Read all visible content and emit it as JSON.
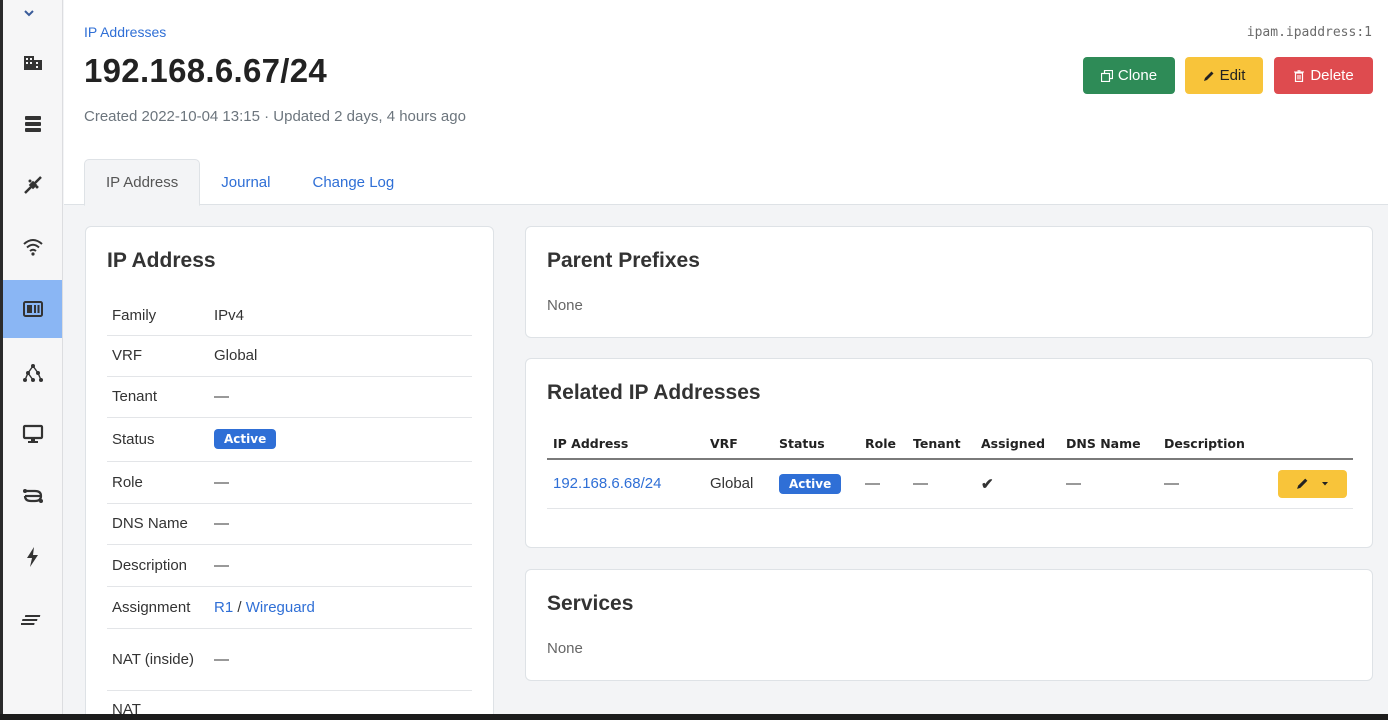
{
  "header": {
    "breadcrumb": "IP Addresses",
    "title": "192.168.6.67/24",
    "meta": "Created 2022-10-04 13:15 · Updated 2 days, 4 hours ago",
    "object_id": "ipam.ipaddress:1",
    "buttons": {
      "clone": "Clone",
      "edit": "Edit",
      "delete": "Delete"
    }
  },
  "tabs": [
    "IP Address",
    "Journal",
    "Change Log"
  ],
  "sidebar": {
    "icons": [
      "organization-icon",
      "devices-icon",
      "connections-icon",
      "wireless-icon",
      "ipam-icon",
      "overlay-icon",
      "virtualization-icon",
      "circuits-icon",
      "power-icon",
      "other-icon"
    ],
    "active": "ipam-icon"
  },
  "ip_card": {
    "title": "IP Address",
    "rows": [
      {
        "label": "Family",
        "value": "IPv4"
      },
      {
        "label": "VRF",
        "value": "Global"
      },
      {
        "label": "Tenant",
        "value": "—"
      },
      {
        "label": "Status",
        "value": "Active"
      },
      {
        "label": "Role",
        "value": "—"
      },
      {
        "label": "DNS Name",
        "value": "—"
      },
      {
        "label": "Description",
        "value": "—"
      },
      {
        "label": "Assignment",
        "device": "R1",
        "separator": "/",
        "interface": "Wireguard"
      },
      {
        "label": "NAT (inside)",
        "value": "—"
      },
      {
        "label": "NAT"
      }
    ]
  },
  "parent_prefixes": {
    "title": "Parent Prefixes",
    "empty": "None"
  },
  "related": {
    "title": "Related IP Addresses",
    "columns": [
      "IP Address",
      "VRF",
      "Status",
      "Role",
      "Tenant",
      "Assigned",
      "DNS Name",
      "Description"
    ],
    "rows": [
      {
        "ip": "192.168.6.68/24",
        "vrf": "Global",
        "status": "Active",
        "role": "—",
        "tenant": "—",
        "assigned": "✔",
        "dns": "—",
        "description": "—"
      }
    ]
  },
  "services": {
    "title": "Services",
    "empty": "None"
  },
  "colors": {
    "link": "#2f6fd6",
    "clone": "#2e8b57",
    "edit": "#f8c43a",
    "delete": "#de4b4f",
    "sidebar_active": "#8ab6f4"
  }
}
